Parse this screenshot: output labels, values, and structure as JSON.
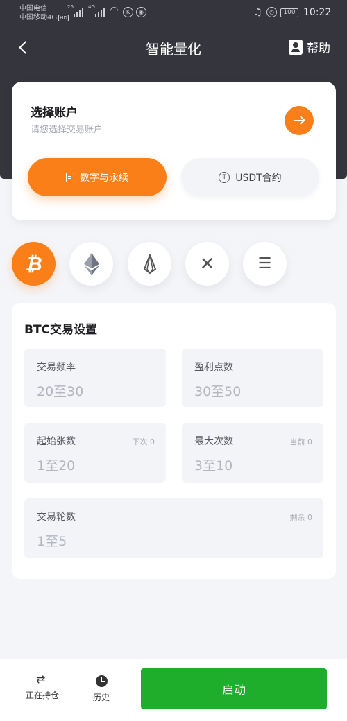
{
  "status_bar": {
    "carrier_1": "中国电信",
    "carrier_2": "中国移动4G",
    "carrier_2_badge": "HD",
    "sig1_tag": "26",
    "sig2_tag": "4G",
    "battery": "100",
    "time": "10:22"
  },
  "nav": {
    "title": "智能量化",
    "help_label": "帮助"
  },
  "account": {
    "title": "选择账户",
    "subtitle": "请您选择交易账户",
    "tabs": [
      {
        "label": "数字与永续",
        "active": true
      },
      {
        "label": "USDT合约",
        "active": false
      }
    ]
  },
  "coins": [
    {
      "icon": "bitcoin-icon",
      "glyph": "₿",
      "selected": true
    },
    {
      "icon": "ethereum-icon",
      "selected": false
    },
    {
      "icon": "eos-icon",
      "selected": false
    },
    {
      "icon": "xrp-icon",
      "glyph": "✕",
      "selected": false
    },
    {
      "icon": "menu-icon",
      "glyph": "☰",
      "selected": false
    }
  ],
  "settings": {
    "title": "BTC交易设置",
    "fields": [
      {
        "label": "交易频率",
        "value": "20至30",
        "note": ""
      },
      {
        "label": "盈利点数",
        "value": "30至50",
        "note": ""
      },
      {
        "label": "起始张数",
        "value": "1至20",
        "note": "下次 0"
      },
      {
        "label": "最大次数",
        "value": "3至10",
        "note": "当前 0"
      },
      {
        "label": "交易轮数",
        "value": "1至5",
        "note": "剩余 0"
      }
    ]
  },
  "bottom": {
    "positions_label": "正在持仓",
    "history_label": "历史",
    "start_label": "启动"
  },
  "colors": {
    "accent": "#fb7f18",
    "header": "#34353d",
    "start": "#1eae2b",
    "background": "#f4f5f9"
  }
}
